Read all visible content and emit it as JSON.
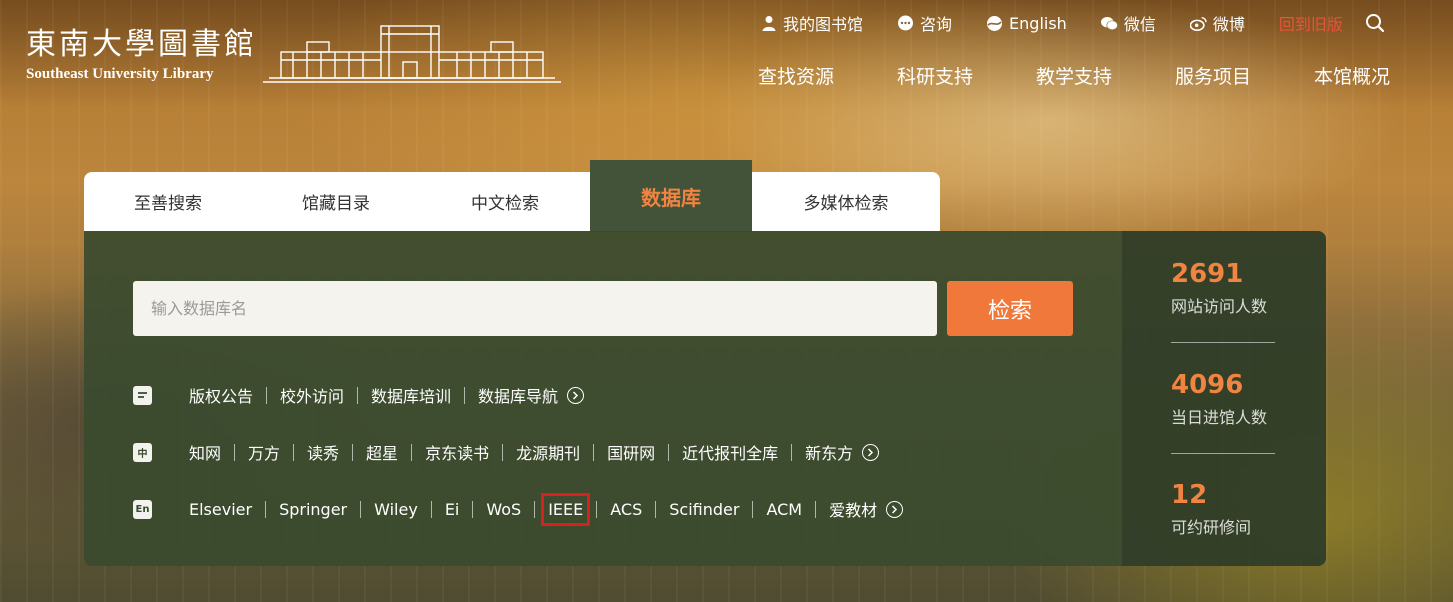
{
  "header": {
    "logo_cn": "東南大學圖書館",
    "logo_en": "Southeast University Library",
    "top_links": [
      {
        "label": "我的图书馆",
        "icon": "user-icon"
      },
      {
        "label": "咨询",
        "icon": "chat-bubble-icon"
      },
      {
        "label": "English",
        "icon": "globe-icon"
      },
      {
        "label": "微信",
        "icon": "wechat-icon"
      },
      {
        "label": "微博",
        "icon": "weibo-icon"
      }
    ],
    "old_version": "回到旧版",
    "nav": [
      "查找资源",
      "科研支持",
      "教学支持",
      "服务项目",
      "本馆概况"
    ]
  },
  "tabs": [
    "至善搜索",
    "馆藏目录",
    "中文检索",
    "数据库",
    "多媒体检索"
  ],
  "active_tab": "数据库",
  "search": {
    "placeholder": "输入数据库名",
    "value": "",
    "button_label": "检索"
  },
  "rows": {
    "notice": {
      "icon": "document-icon",
      "items": [
        "版权公告",
        "校外访问",
        "数据库培训",
        "数据库导航"
      ]
    },
    "chinese": {
      "icon": "chinese-icon",
      "icon_text": "中",
      "items": [
        "知网",
        "万方",
        "读秀",
        "超星",
        "京东读书",
        "龙源期刊",
        "国研网",
        "近代报刊全库",
        "新东方"
      ]
    },
    "english": {
      "icon": "english-icon",
      "icon_text": "En",
      "items": [
        "Elsevier",
        "Springer",
        "Wiley",
        "Ei",
        "WoS",
        "IEEE",
        "ACS",
        "Scifinder",
        "ACM",
        "爱教材"
      ],
      "highlighted": "IEEE"
    }
  },
  "stats": [
    {
      "value": "2691",
      "label": "网站访问人数"
    },
    {
      "value": "4096",
      "label": "当日进馆人数"
    },
    {
      "value": "12",
      "label": "可约研修间"
    }
  ],
  "colors": {
    "accent": "#f08440",
    "button": "#f0783a",
    "panel": "#3a4a2e",
    "old_version": "#e8533a",
    "highlight_box": "#d8201c"
  }
}
